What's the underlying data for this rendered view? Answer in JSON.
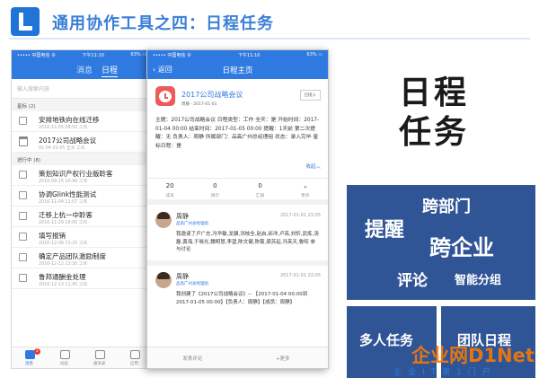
{
  "slide": {
    "title": "通用协作工具之四：日程任务",
    "big_line1": "日程",
    "big_line2": "任务"
  },
  "phone1": {
    "status_carrier": "••••• 中国电信 令",
    "status_time": "下午11:10",
    "status_battery": "63% ▭",
    "tabs": [
      "消息",
      "日程"
    ],
    "active_tab": "日程",
    "search_placeholder": "输入搜索内容",
    "starred_header": "星标 (2)",
    "starred": [
      {
        "title": "安排地铁向在线迁移",
        "date": "2016-12-05 08:50 工作",
        "icon": "checkbox-icon"
      },
      {
        "title": "2017公司战略会议",
        "date": "01-04 01-05 全天 工作",
        "icon": "calendar-icon"
      }
    ],
    "inprogress_header": "进行中 (8)",
    "inprogress": [
      {
        "title": "策划知识产权行业版聆客",
        "date": "2016-09-15 10:40 工作"
      },
      {
        "title": "协调Glink性能测试",
        "date": "2016-11-04 11:07 工作"
      },
      {
        "title": "迁移上杭一中聆客",
        "date": "2016-11-29 16:00 工作"
      },
      {
        "title": "填写报销",
        "date": "2016-12-06 13:25 工作"
      },
      {
        "title": "确定产品团队激励制度",
        "date": "2016-12-12 13:30 工作"
      },
      {
        "title": "鲁邦通酬金处理",
        "date": "2016-12-13 11:45 工作"
      }
    ],
    "bottom_tabs": [
      "消息",
      "动态",
      "通讯录",
      "应用"
    ],
    "badge_count": "2"
  },
  "phone2": {
    "status_carrier": "••••• 中国电信 令",
    "status_time": "下午11:10",
    "status_battery": "63% ▭",
    "back_label": "返回",
    "nav_title": "日程主页",
    "event_title": "2017公司战略会议",
    "event_meta": "周静  ·  2017-01-01",
    "event_status": "已接入",
    "detail": "主题：2017公司战略会议  日程类型：工作  全天：是  开始时间：2017-01-04 00:00  结束时间：2017-01-05 00:00  提醒：1天前  第二次提醒：无  负责人：周静  所属部门：品高广州总经理组  状态：录入完毕  星标日程：是",
    "collapse_label": "收起",
    "stats": [
      {
        "value": "20",
        "label": "成员"
      },
      {
        "value": "0",
        "label": "请示"
      },
      {
        "value": "0",
        "label": "汇报"
      },
      {
        "value": "⌄",
        "label": "更多"
      }
    ],
    "comments": [
      {
        "name": "周静",
        "time": "2017-01-01 23:05",
        "dept": "品高广州总经理组",
        "text": "我邀请了卢广志,冯华敏,龙骥,洪枝全,赵启,邱洋,卢亮,刘忻,武炼,汤磊,黄海,于晓光,魏明慧,李望,陈文健,陈菊,梁苏延,冯芙天,鲁晖 参与讨论"
      },
      {
        "name": "周静",
        "time": "2017-01-01 23:05",
        "dept": "品高广州总经理组",
        "text": "我创建了《2017公司战略会议》-- 【2017-01-04 00:00到2017-01-05 00:00】【负责人：周静】【成员：周静】"
      }
    ],
    "actions": [
      "发表评论",
      "+更多"
    ]
  },
  "tiles": {
    "main": [
      "提醒",
      "跨部门",
      "跨企业",
      "评论",
      "智能分组"
    ],
    "bottom_left": "多人任务",
    "bottom_right": "团队日程"
  },
  "watermark": {
    "main": "企业网D1Net",
    "sub": "企业IT第1门户"
  },
  "colors": {
    "brand_blue": "#2f7ae0",
    "tile_blue": "#2f5597",
    "watermark_orange": "#ff7a00"
  }
}
